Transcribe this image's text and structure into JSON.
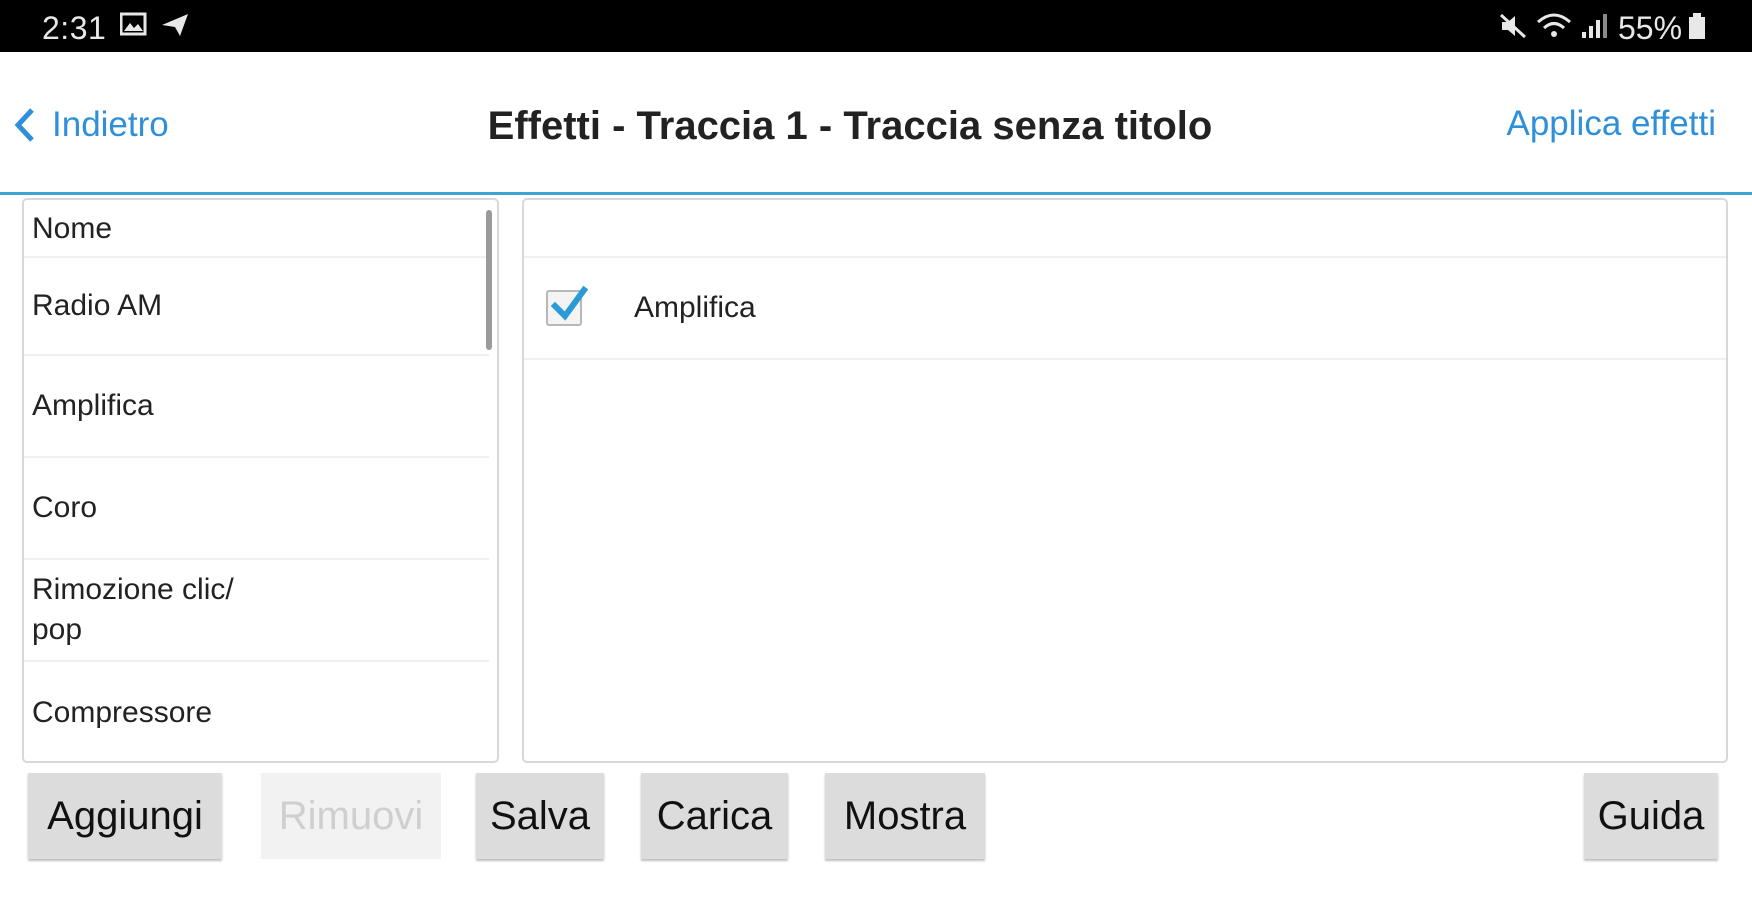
{
  "status_bar": {
    "time": "2:31",
    "battery": "55%",
    "icons": [
      "image-icon",
      "send-icon",
      "mute-icon",
      "wifi-icon",
      "signal-icon",
      "battery-icon"
    ]
  },
  "header": {
    "back_label": "Indietro",
    "title": "Effetti - Traccia 1 - Traccia senza titolo",
    "apply_label": "Applica effetti"
  },
  "effects_list": {
    "header": "Nome",
    "items": [
      {
        "label": "Radio AM"
      },
      {
        "label": "Amplifica"
      },
      {
        "label": "Coro"
      },
      {
        "label": "Rimozione clic/\npop"
      },
      {
        "label": "Compressore"
      }
    ]
  },
  "applied_effects": [
    {
      "checked": true,
      "label": "Amplifica"
    }
  ],
  "buttons": {
    "add": "Aggiungi",
    "remove": "Rimuovi",
    "save": "Salva",
    "load": "Carica",
    "show": "Mostra",
    "help": "Guida"
  },
  "colors": {
    "accent": "#2f8fd8",
    "header_divider": "#3da4d8",
    "check": "#2a9bd6"
  }
}
